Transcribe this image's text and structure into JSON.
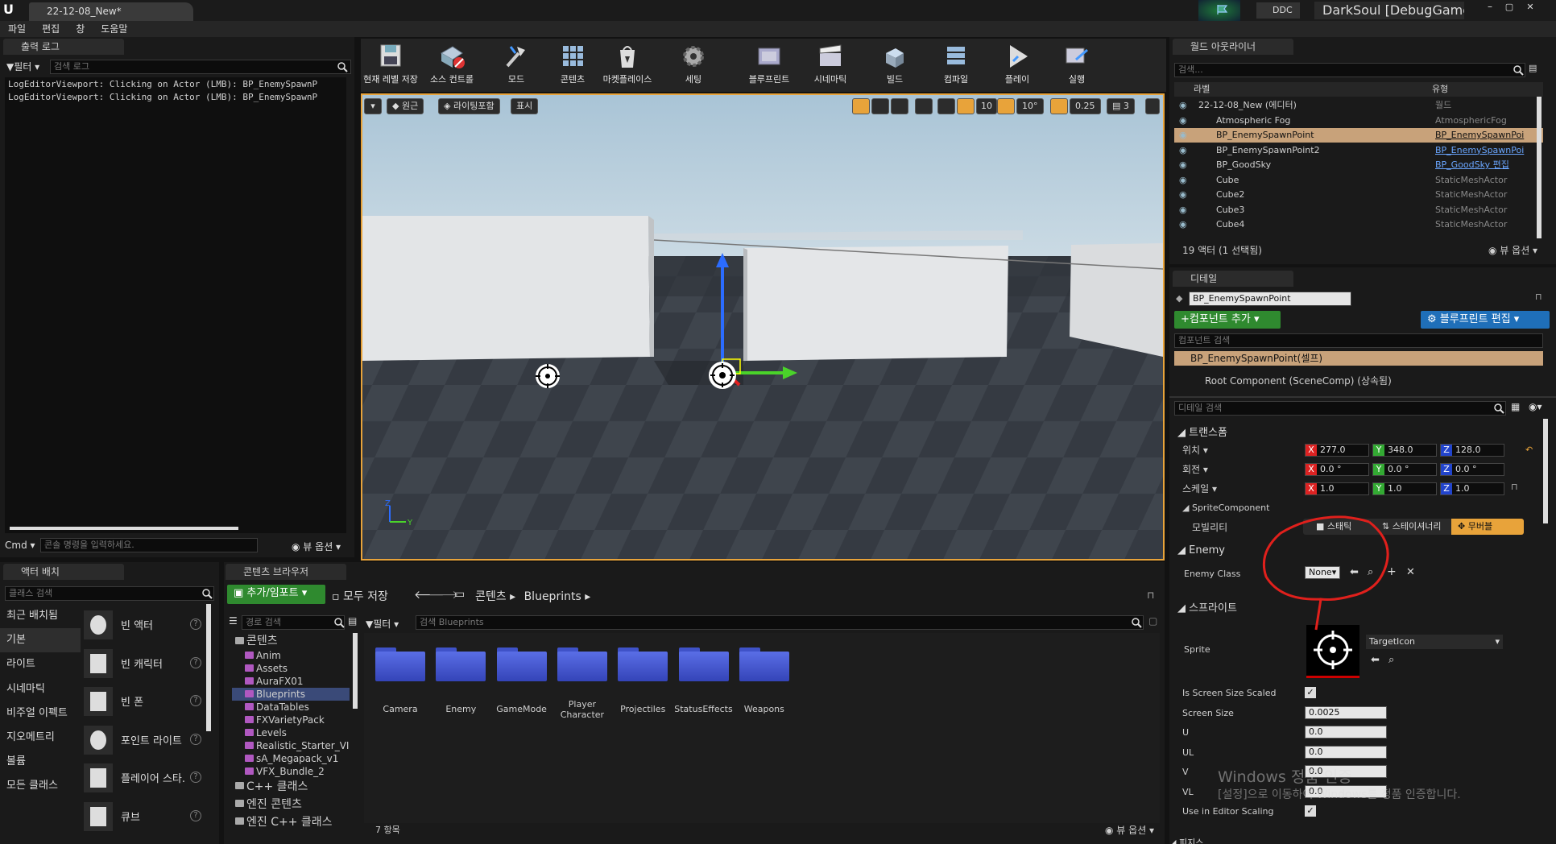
{
  "window": {
    "tab_title": "22-12-08_New*",
    "ddc_label": "DDC",
    "app_title": "DarkSoul [DebugGame]"
  },
  "menu": [
    "파일",
    "편집",
    "창",
    "도움말"
  ],
  "output_log": {
    "tab": "출력 로그",
    "filter_label": "필터",
    "search_placeholder": "검색 로그",
    "lines": [
      "LogEditorViewport: Clicking on Actor (LMB): BP_EnemySpawnP",
      "LogEditorViewport: Clicking on Actor (LMB): BP_EnemySpawnP"
    ],
    "cmd_label": "Cmd",
    "cmd_placeholder": "콘솔 명령을 입력하세요.",
    "view_options": "뷰 옵션"
  },
  "toolbar": {
    "buttons": [
      "현재 레벨 저장",
      "소스 컨트롤",
      "모드",
      "콘텐츠",
      "마켓플레이스",
      "세팅",
      "블루프린트",
      "시네마틱",
      "빌드",
      "컴파일",
      "플레이",
      "실행"
    ]
  },
  "viewport": {
    "perspective": "원근",
    "lighting": "라이팅포함",
    "show": "표시",
    "grid_snap": "10",
    "rotation_snap": "10°",
    "scale_snap": "0.25",
    "camera_speed": "3"
  },
  "outliner": {
    "tab": "월드 아웃라이너",
    "search_placeholder": "검색...",
    "col_label": "라벨",
    "col_type": "유형",
    "rows": [
      {
        "label": "22-12-08_New (에디터)",
        "type": "월드"
      },
      {
        "label": "Atmospheric Fog",
        "type": "AtmosphericFog"
      },
      {
        "label": "BP_EnemySpawnPoint",
        "type": "BP_EnemySpawnPoi"
      },
      {
        "label": "BP_EnemySpawnPoint2",
        "type": "BP_EnemySpawnPoi"
      },
      {
        "label": "BP_GoodSky",
        "type": "BP_GoodSky 편집"
      },
      {
        "label": "Cube",
        "type": "StaticMeshActor"
      },
      {
        "label": "Cube2",
        "type": "StaticMeshActor"
      },
      {
        "label": "Cube3",
        "type": "StaticMeshActor"
      },
      {
        "label": "Cube4",
        "type": "StaticMeshActor"
      }
    ],
    "status": "19 액터 (1 선택됨)",
    "view_options": "뷰 옵션"
  },
  "details": {
    "tab": "디테일",
    "name_value": "BP_EnemySpawnPoint",
    "add_component": "컴포넌트 추가",
    "edit_blueprint": "블루프린트 편집",
    "component_search": "컴포넌트 검색",
    "self_component": "BP_EnemySpawnPoint(셀프)",
    "root_component": "Root Component (SceneComp) (상속됨)",
    "detail_search": "디테일 검색",
    "transform_header": "트랜스폼",
    "location_label": "위치",
    "rotation_label": "회전",
    "scale_label": "스케일",
    "location": [
      "277.0",
      "348.0",
      "128.0"
    ],
    "rotation": [
      "0.0 °",
      "0.0 °",
      "0.0 °"
    ],
    "scale": [
      "1.0",
      "1.0",
      "1.0"
    ],
    "sprite_component": "SpriteComponent",
    "mobility_label": "모빌리티",
    "mobility_options": [
      "스태틱",
      "스테이셔너리",
      "무버블"
    ],
    "enemy_header": "Enemy",
    "enemy_class_label": "Enemy Class",
    "enemy_class_value": "None",
    "sprite_header": "스프라이트",
    "sprite_label": "Sprite",
    "sprite_asset": "TargetIcon",
    "props": [
      {
        "label": "Is Screen Size Scaled",
        "value": ""
      },
      {
        "label": "Screen Size",
        "value": "0.0025"
      },
      {
        "label": "U",
        "value": "0.0"
      },
      {
        "label": "UL",
        "value": "0.0"
      },
      {
        "label": "V",
        "value": "0.0"
      },
      {
        "label": "VL",
        "value": "0.0"
      },
      {
        "label": "Use in Editor Scaling",
        "value": ""
      }
    ],
    "next_header": "피지스"
  },
  "activation_watermark": {
    "title": "Windows 정품 인증",
    "subtitle": "[설정]으로 이동하여 Windows를 정품 인증합니다."
  },
  "place_actors": {
    "tab": "액터 배치",
    "search_placeholder": "클래스 검색",
    "categories": [
      "최근 배치됨",
      "기본",
      "라이트",
      "시네마틱",
      "비주얼 이펙트",
      "지오메트리",
      "볼륨",
      "모든 클래스"
    ],
    "items": [
      "빈 액터",
      "빈 캐릭터",
      "빈 폰",
      "포인트 라이트",
      "플레이어 스타.",
      "큐브"
    ]
  },
  "content_browser": {
    "tab": "콘텐츠 브라우저",
    "add_import": "추가/임포트",
    "save_all": "모두 저장",
    "path": [
      "콘텐츠",
      "Blueprints"
    ],
    "path_search": "경로 검색",
    "filter_label": "필터",
    "search_placeholder": "검색 Blueprints",
    "tree": [
      {
        "label": "콘텐츠",
        "kind": "root"
      },
      {
        "label": "Anim",
        "kind": "child"
      },
      {
        "label": "Assets",
        "kind": "child"
      },
      {
        "label": "AuraFX01",
        "kind": "child"
      },
      {
        "label": "Blueprints",
        "kind": "selected"
      },
      {
        "label": "DataTables",
        "kind": "child"
      },
      {
        "label": "FXVarietyPack",
        "kind": "child"
      },
      {
        "label": "Levels",
        "kind": "child"
      },
      {
        "label": "Realistic_Starter_VI",
        "kind": "child"
      },
      {
        "label": "sA_Megapack_v1",
        "kind": "child"
      },
      {
        "label": "VFX_Bundle_2",
        "kind": "child"
      },
      {
        "label": "C++ 클래스",
        "kind": "root"
      },
      {
        "label": "엔진 콘텐츠",
        "kind": "root"
      },
      {
        "label": "엔진 C++ 클래스",
        "kind": "root"
      }
    ],
    "folders": [
      "Camera",
      "Enemy",
      "GameMode",
      "Player Character",
      "Projectiles",
      "StatusEffects",
      "Weapons"
    ],
    "item_count": "7 항목",
    "view_options": "뷰 옵션"
  },
  "colors": {
    "accent_orange": "#e8a33a",
    "selection": "#c8a27a",
    "annotation_red": "#e0201c",
    "add_green": "#2f8a2f",
    "edit_blue": "#1f6fb9"
  }
}
